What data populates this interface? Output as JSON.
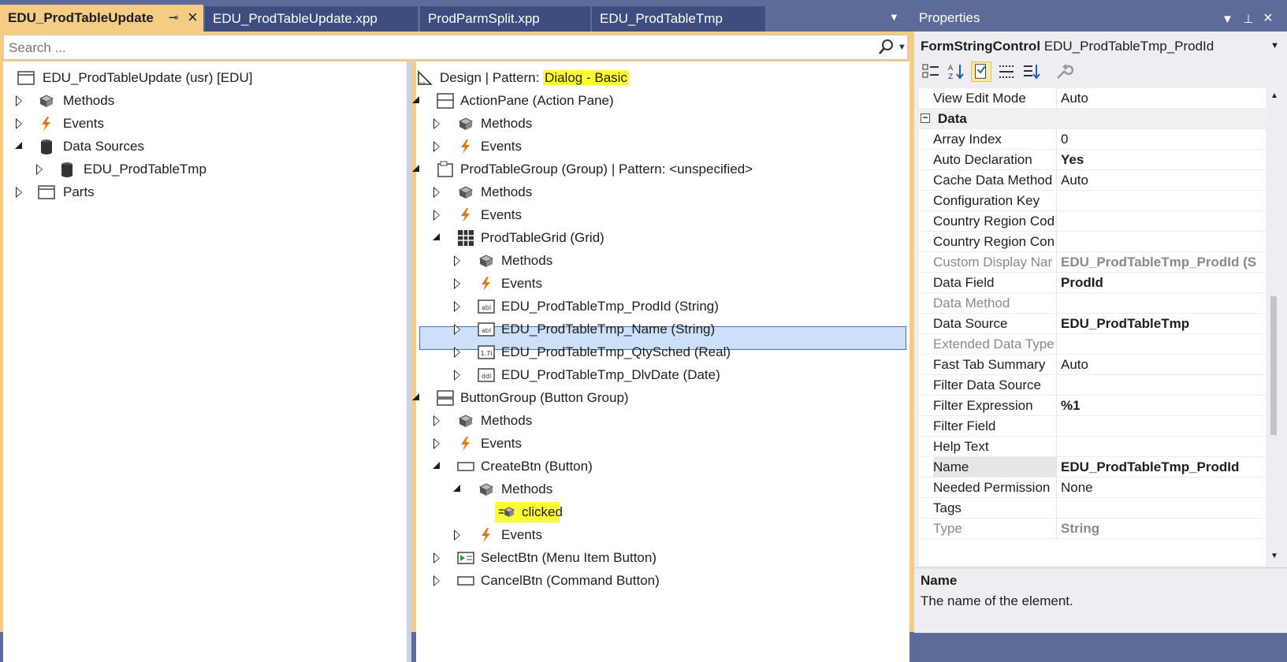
{
  "tabs": [
    {
      "label": "EDU_ProdTableUpdate",
      "active": true
    },
    {
      "label": "EDU_ProdTableUpdate.xpp"
    },
    {
      "label": "ProdParmSplit.xpp"
    },
    {
      "label": "EDU_ProdTableTmp"
    }
  ],
  "search": {
    "placeholder": "Search ..."
  },
  "left_tree": {
    "root": "EDU_ProdTableUpdate (usr) [EDU]",
    "methods": "Methods",
    "events": "Events",
    "data_sources": "Data Sources",
    "ds_item": "EDU_ProdTableTmp",
    "parts": "Parts"
  },
  "right_tree": {
    "design": "Design | Pattern: ",
    "design_pattern": "Dialog - Basic",
    "action_pane": "ActionPane (Action Pane)",
    "methods": "Methods",
    "events": "Events",
    "prod_table_group": "ProdTableGroup (Group) | Pattern: <unspecified>",
    "prod_table_grid": "ProdTableGrid (Grid)",
    "field_prodid": "EDU_ProdTableTmp_ProdId (String)",
    "field_name": "EDU_ProdTableTmp_Name (String)",
    "field_qty": "EDU_ProdTableTmp_QtySched (Real)",
    "field_date": "EDU_ProdTableTmp_DlvDate (Date)",
    "button_group": "ButtonGroup (Button Group)",
    "create_btn": "CreateBtn (Button)",
    "clicked": "clicked",
    "select_btn": "SelectBtn (Menu Item Button)",
    "cancel_btn": "CancelBtn (Command Button)",
    "icon_text": {
      "string": "abl",
      "real": "1.7i",
      "date": "ddl"
    }
  },
  "properties": {
    "title": "Properties",
    "object_type": "FormStringControl",
    "object_name": "EDU_ProdTableTmp_ProdId",
    "top_row": {
      "name": "View Edit Mode",
      "value": "Auto"
    },
    "category": "Data",
    "rows": [
      {
        "name": "Array Index",
        "value": "0"
      },
      {
        "name": "Auto Declaration",
        "value": "Yes"
      },
      {
        "name": "Cache Data Method",
        "value": "Auto"
      },
      {
        "name": "Configuration Key",
        "value": ""
      },
      {
        "name": "Country Region Cod",
        "value": ""
      },
      {
        "name": "Country Region Con",
        "value": ""
      },
      {
        "name": "Custom Display Nar",
        "value": "EDU_ProdTableTmp_ProdId (S"
      },
      {
        "name": "Data Field",
        "value": "ProdId"
      },
      {
        "name": "Data Method",
        "value": ""
      },
      {
        "name": "Data Source",
        "value": "EDU_ProdTableTmp"
      },
      {
        "name": "Extended Data Type",
        "value": ""
      },
      {
        "name": "Fast Tab Summary",
        "value": "Auto"
      },
      {
        "name": "Filter Data Source",
        "value": ""
      },
      {
        "name": "Filter Expression",
        "value": "%1"
      },
      {
        "name": "Filter Field",
        "value": ""
      },
      {
        "name": "Help Text",
        "value": ""
      },
      {
        "name": "Name",
        "value": "EDU_ProdTableTmp_ProdId"
      },
      {
        "name": "Needed Permission",
        "value": "None"
      },
      {
        "name": "Tags",
        "value": ""
      },
      {
        "name": "Type",
        "value": "String"
      }
    ],
    "description_title": "Name",
    "description_text": "The name of the element."
  },
  "colors": {
    "active_tab": "#f5cc84",
    "selection": "#cce0f7",
    "highlight": "#ffff33",
    "chrome": "#5d6b99"
  }
}
